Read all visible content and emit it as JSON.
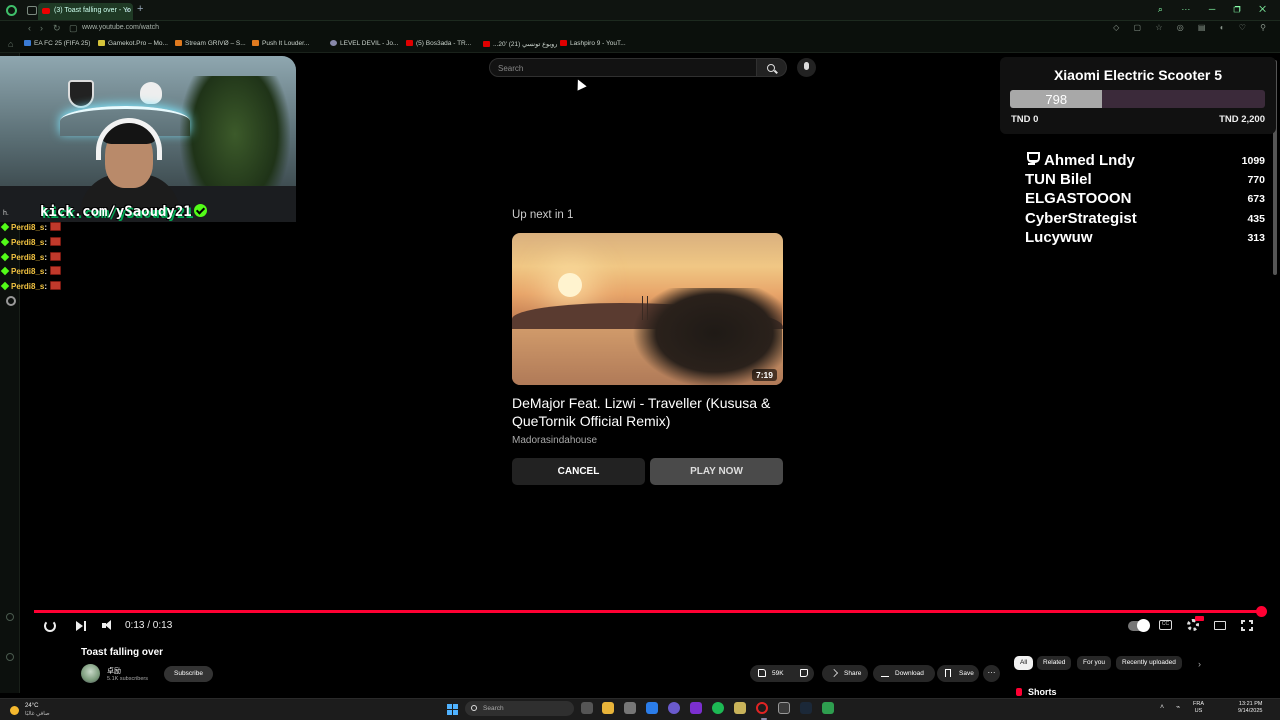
{
  "browser": {
    "active_tab_title": "(3) Toast falling over - Yo",
    "url": "www.youtube.com/watch",
    "bookmarks": [
      {
        "label": "EA FC 25 (FIFA 25)",
        "color": "#3a7bd5"
      },
      {
        "label": "Gamekot.Pro – Mo...",
        "color": "#d5c43a"
      },
      {
        "label": "Stream GRIVØ – S...",
        "color": "#e07a1f"
      },
      {
        "label": "Push It Louder...",
        "color": "#e07a1f"
      },
      {
        "label": "LEVEL DEVIL - Jo...",
        "color": "#88a"
      },
      {
        "label": "(5) Bos3ada - TR...",
        "color": "#e00000"
      },
      {
        "label": "...20' روبوع تونسي (21)",
        "color": "#e00000"
      },
      {
        "label": "Lashpiro 9 - YouT...",
        "color": "#e00000"
      }
    ]
  },
  "youtube": {
    "search_placeholder": "Search"
  },
  "overlay": {
    "kick_link": "kick.com/ySaoudy21",
    "chat": {
      "header": "h.",
      "messages": [
        {
          "user": "Perdi8_s",
          "sep": ":"
        },
        {
          "user": "Perdi8_s",
          "sep": ":"
        },
        {
          "user": "Perdi8_s",
          "sep": ":"
        },
        {
          "user": "Perdi8_s",
          "sep": ":"
        },
        {
          "user": "Perdi8_s",
          "sep": ":"
        }
      ]
    },
    "goal": {
      "title": "Xiaomi Electric Scooter 5",
      "current": "798",
      "min": "TND 0",
      "max": "TND 2,200",
      "fraction": 0.3627
    },
    "leaderboard": [
      {
        "name": "Ahmed Lndy",
        "score": "1099"
      },
      {
        "name": "TUN Bilel",
        "score": "770"
      },
      {
        "name": "ELGASTOOON",
        "score": "673"
      },
      {
        "name": "CyberStrategist",
        "score": "435"
      },
      {
        "name": "Lucywuw",
        "score": "313"
      }
    ]
  },
  "up_next": {
    "label": "Up next in 1",
    "duration": "7:19",
    "title": "DeMajor Feat. Lizwi - Traveller (Kususa & QueTornik Official Remix)",
    "channel": "Madorasindahouse",
    "cancel_label": "CANCEL",
    "play_label": "PLAY NOW"
  },
  "player": {
    "time": "0:13 / 0:13",
    "progress": 1.0,
    "cc_label": "CC"
  },
  "video": {
    "title": "Toast falling over",
    "channel_name": "卓励",
    "subscribers": "5.1K subscribers",
    "subscribe_label": "Subscribe",
    "likes": "59K",
    "share_label": "Share",
    "download_label": "Download",
    "save_label": "Save",
    "more_label": "···"
  },
  "chips": [
    "All",
    "Related",
    "For you",
    "Recently uploaded"
  ],
  "shorts_label": "Shorts",
  "taskbar": {
    "weather_temp": "24°C",
    "weather_desc": "صافي غالبًا",
    "search_placeholder": "Search",
    "lang_line1": "FRA",
    "lang_line2": "US",
    "time": "13:21 PM",
    "date": "9/14/2025"
  }
}
